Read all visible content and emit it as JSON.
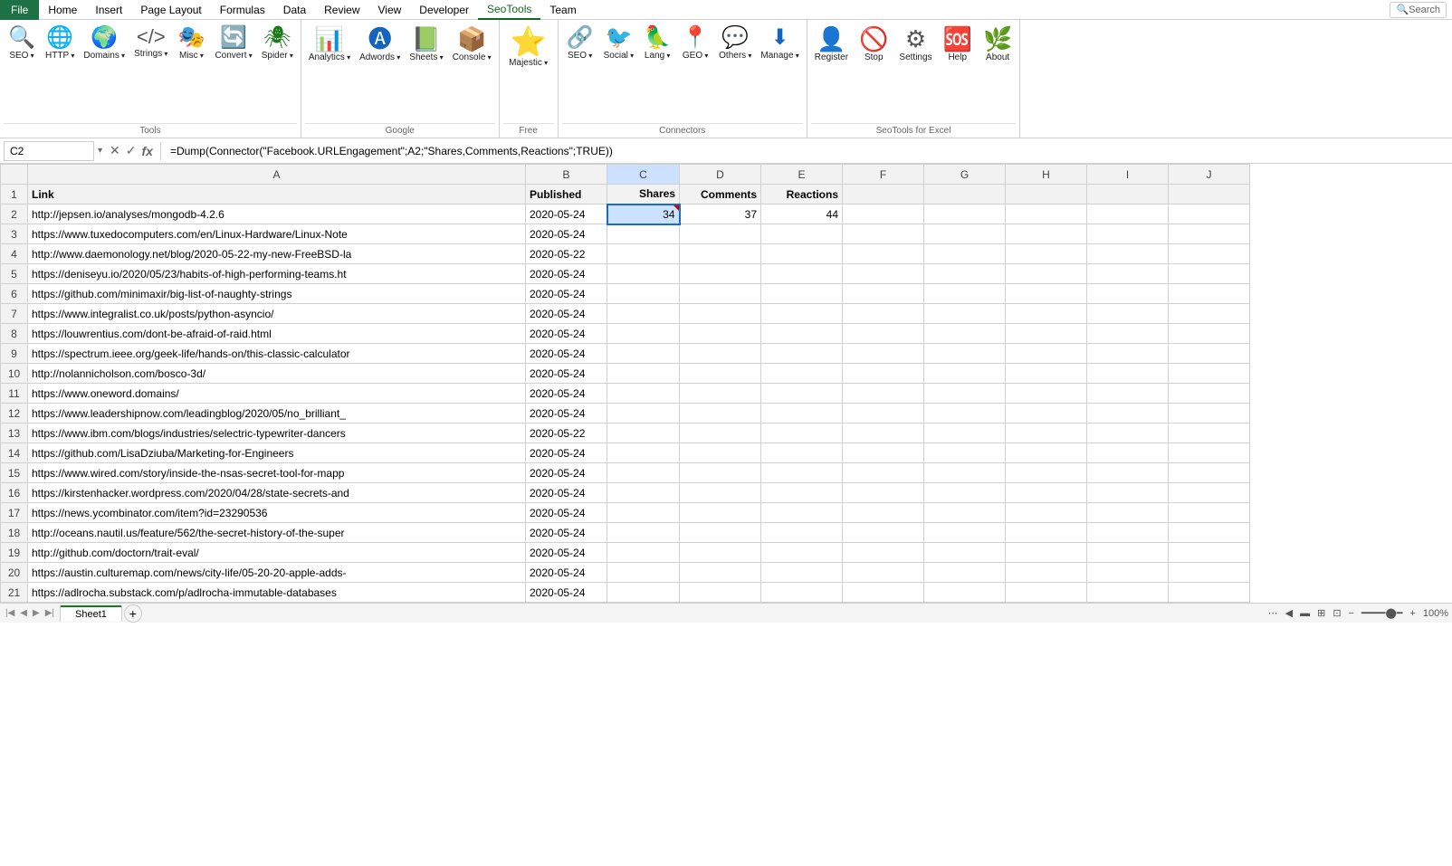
{
  "menu": {
    "file": "File",
    "items": [
      "Home",
      "Insert",
      "Page Layout",
      "Formulas",
      "Data",
      "Review",
      "View",
      "Developer",
      "SeoTools",
      "Team",
      "Search"
    ]
  },
  "ribbon": {
    "tools_group": {
      "label": "Tools",
      "buttons": [
        {
          "id": "seo",
          "label": "SEO",
          "icon": "🔍",
          "has_arrow": true
        },
        {
          "id": "http",
          "label": "HTTP",
          "icon": "🌐",
          "has_arrow": true
        },
        {
          "id": "domains",
          "label": "Domains",
          "icon": "🌍",
          "has_arrow": true
        },
        {
          "id": "strings",
          "label": "Strings",
          "icon": "⟨/⟩",
          "has_arrow": true
        },
        {
          "id": "misc",
          "label": "Misc",
          "icon": "⚙",
          "has_arrow": true
        },
        {
          "id": "convert",
          "label": "Convert",
          "icon": "🔄",
          "has_arrow": true
        },
        {
          "id": "spider",
          "label": "Spider",
          "icon": "🕷",
          "has_arrow": true
        }
      ]
    },
    "google_group": {
      "label": "Google",
      "buttons": [
        {
          "id": "analytics",
          "label": "Analytics",
          "icon": "📊",
          "has_arrow": true
        },
        {
          "id": "adwords",
          "label": "Adwords",
          "icon": "A",
          "has_arrow": true
        },
        {
          "id": "sheets",
          "label": "Sheets",
          "icon": "📋",
          "has_arrow": true
        },
        {
          "id": "console",
          "label": "Console",
          "icon": "📦",
          "has_arrow": true
        }
      ]
    },
    "free_group": {
      "label": "Free",
      "buttons": [
        {
          "id": "majestic",
          "label": "Majestic",
          "icon": "⭐",
          "has_arrow": true
        }
      ]
    },
    "connectors_group": {
      "label": "Connectors",
      "buttons": [
        {
          "id": "seo2",
          "label": "SEO",
          "icon": "🔗",
          "has_arrow": true
        },
        {
          "id": "social",
          "label": "Social",
          "icon": "🐦",
          "has_arrow": true
        },
        {
          "id": "lang",
          "label": "Lang",
          "icon": "🦜",
          "has_arrow": true
        },
        {
          "id": "geo",
          "label": "GEO",
          "icon": "📍",
          "has_arrow": true
        },
        {
          "id": "others",
          "label": "Others",
          "icon": "💬",
          "has_arrow": true
        },
        {
          "id": "manage",
          "label": "Manage",
          "icon": "⬇",
          "has_arrow": true
        }
      ]
    },
    "seotools_group": {
      "label": "SeoTools for Excel",
      "buttons": [
        {
          "id": "register",
          "label": "Register",
          "icon": "👤"
        },
        {
          "id": "stop",
          "label": "Stop",
          "icon": "🚫"
        },
        {
          "id": "settings",
          "label": "Settings",
          "icon": "⚙"
        },
        {
          "id": "help",
          "label": "Help",
          "icon": "🆘"
        },
        {
          "id": "about",
          "label": "About",
          "icon": "🌿"
        }
      ]
    }
  },
  "formula_bar": {
    "cell_ref": "C2",
    "formula": "=Dump(Connector(\"Facebook.URLEngagement\";A2;\"Shares,Comments,Reactions\";TRUE))"
  },
  "columns": {
    "row_header": "",
    "headers": [
      "A",
      "B",
      "C",
      "D",
      "E",
      "F",
      "G",
      "H",
      "I",
      "J"
    ],
    "widths": [
      550,
      90,
      80,
      90,
      90,
      90,
      90,
      90,
      90,
      90
    ]
  },
  "rows": [
    {
      "row": 1,
      "cells": [
        "Link",
        "Published",
        "Shares",
        "Comments",
        "Reactions",
        "",
        "",
        "",
        "",
        ""
      ]
    },
    {
      "row": 2,
      "cells": [
        "http://jepsen.io/analyses/mongodb-4.2.6",
        "2020-05-24",
        "34",
        "37",
        "44",
        "",
        "",
        "",
        "",
        ""
      ],
      "selected": true
    },
    {
      "row": 3,
      "cells": [
        "https://www.tuxedocomputers.com/en/Linux-Hardware/Linux-Note",
        "2020-05-24",
        "",
        "",
        "",
        "",
        "",
        "",
        "",
        ""
      ]
    },
    {
      "row": 4,
      "cells": [
        "http://www.daemonology.net/blog/2020-05-22-my-new-FreeBSD-la",
        "2020-05-22",
        "",
        "",
        "",
        "",
        "",
        "",
        "",
        ""
      ]
    },
    {
      "row": 5,
      "cells": [
        "https://deniseyu.io/2020/05/23/habits-of-high-performing-teams.ht",
        "2020-05-24",
        "",
        "",
        "",
        "",
        "",
        "",
        "",
        ""
      ]
    },
    {
      "row": 6,
      "cells": [
        "https://github.com/minimaxir/big-list-of-naughty-strings",
        "2020-05-24",
        "",
        "",
        "",
        "",
        "",
        "",
        "",
        ""
      ]
    },
    {
      "row": 7,
      "cells": [
        "https://www.integralist.co.uk/posts/python-asyncio/",
        "2020-05-24",
        "",
        "",
        "",
        "",
        "",
        "",
        "",
        ""
      ]
    },
    {
      "row": 8,
      "cells": [
        "https://louwrentius.com/dont-be-afraid-of-raid.html",
        "2020-05-24",
        "",
        "",
        "",
        "",
        "",
        "",
        "",
        ""
      ]
    },
    {
      "row": 9,
      "cells": [
        "https://spectrum.ieee.org/geek-life/hands-on/this-classic-calculator",
        "2020-05-24",
        "",
        "",
        "",
        "",
        "",
        "",
        "",
        ""
      ]
    },
    {
      "row": 10,
      "cells": [
        "http://nolannicholson.com/bosco-3d/",
        "2020-05-24",
        "",
        "",
        "",
        "",
        "",
        "",
        "",
        ""
      ]
    },
    {
      "row": 11,
      "cells": [
        "https://www.oneword.domains/",
        "2020-05-24",
        "",
        "",
        "",
        "",
        "",
        "",
        "",
        ""
      ]
    },
    {
      "row": 12,
      "cells": [
        "https://www.leadershipnow.com/leadingblog/2020/05/no_brilliant_",
        "2020-05-24",
        "",
        "",
        "",
        "",
        "",
        "",
        "",
        ""
      ]
    },
    {
      "row": 13,
      "cells": [
        "https://www.ibm.com/blogs/industries/selectric-typewriter-dancers",
        "2020-05-22",
        "",
        "",
        "",
        "",
        "",
        "",
        "",
        ""
      ]
    },
    {
      "row": 14,
      "cells": [
        "https://github.com/LisaDziuba/Marketing-for-Engineers",
        "2020-05-24",
        "",
        "",
        "",
        "",
        "",
        "",
        "",
        ""
      ]
    },
    {
      "row": 15,
      "cells": [
        "https://www.wired.com/story/inside-the-nsas-secret-tool-for-mapp",
        "2020-05-24",
        "",
        "",
        "",
        "",
        "",
        "",
        "",
        ""
      ]
    },
    {
      "row": 16,
      "cells": [
        "https://kirstenhacker.wordpress.com/2020/04/28/state-secrets-and",
        "2020-05-24",
        "",
        "",
        "",
        "",
        "",
        "",
        "",
        ""
      ]
    },
    {
      "row": 17,
      "cells": [
        "https://news.ycombinator.com/item?id=23290536",
        "2020-05-24",
        "",
        "",
        "",
        "",
        "",
        "",
        "",
        ""
      ]
    },
    {
      "row": 18,
      "cells": [
        "http://oceans.nautil.us/feature/562/the-secret-history-of-the-super",
        "2020-05-24",
        "",
        "",
        "",
        "",
        "",
        "",
        "",
        ""
      ]
    },
    {
      "row": 19,
      "cells": [
        "http://github.com/doctorn/trait-eval/",
        "2020-05-24",
        "",
        "",
        "",
        "",
        "",
        "",
        "",
        ""
      ]
    },
    {
      "row": 20,
      "cells": [
        "https://austin.culturemap.com/news/city-life/05-20-20-apple-adds-",
        "2020-05-24",
        "",
        "",
        "",
        "",
        "",
        "",
        "",
        ""
      ]
    },
    {
      "row": 21,
      "cells": [
        "https://adlrocha.substack.com/p/adlrocha-immutable-databases",
        "2020-05-24",
        "",
        "",
        "",
        "",
        "",
        "",
        "",
        ""
      ]
    }
  ],
  "sheet_tabs": [
    {
      "label": "Sheet1",
      "active": true
    }
  ],
  "bottom": {
    "add_sheet": "+",
    "scroll_label": "",
    "zoom": "100%"
  }
}
